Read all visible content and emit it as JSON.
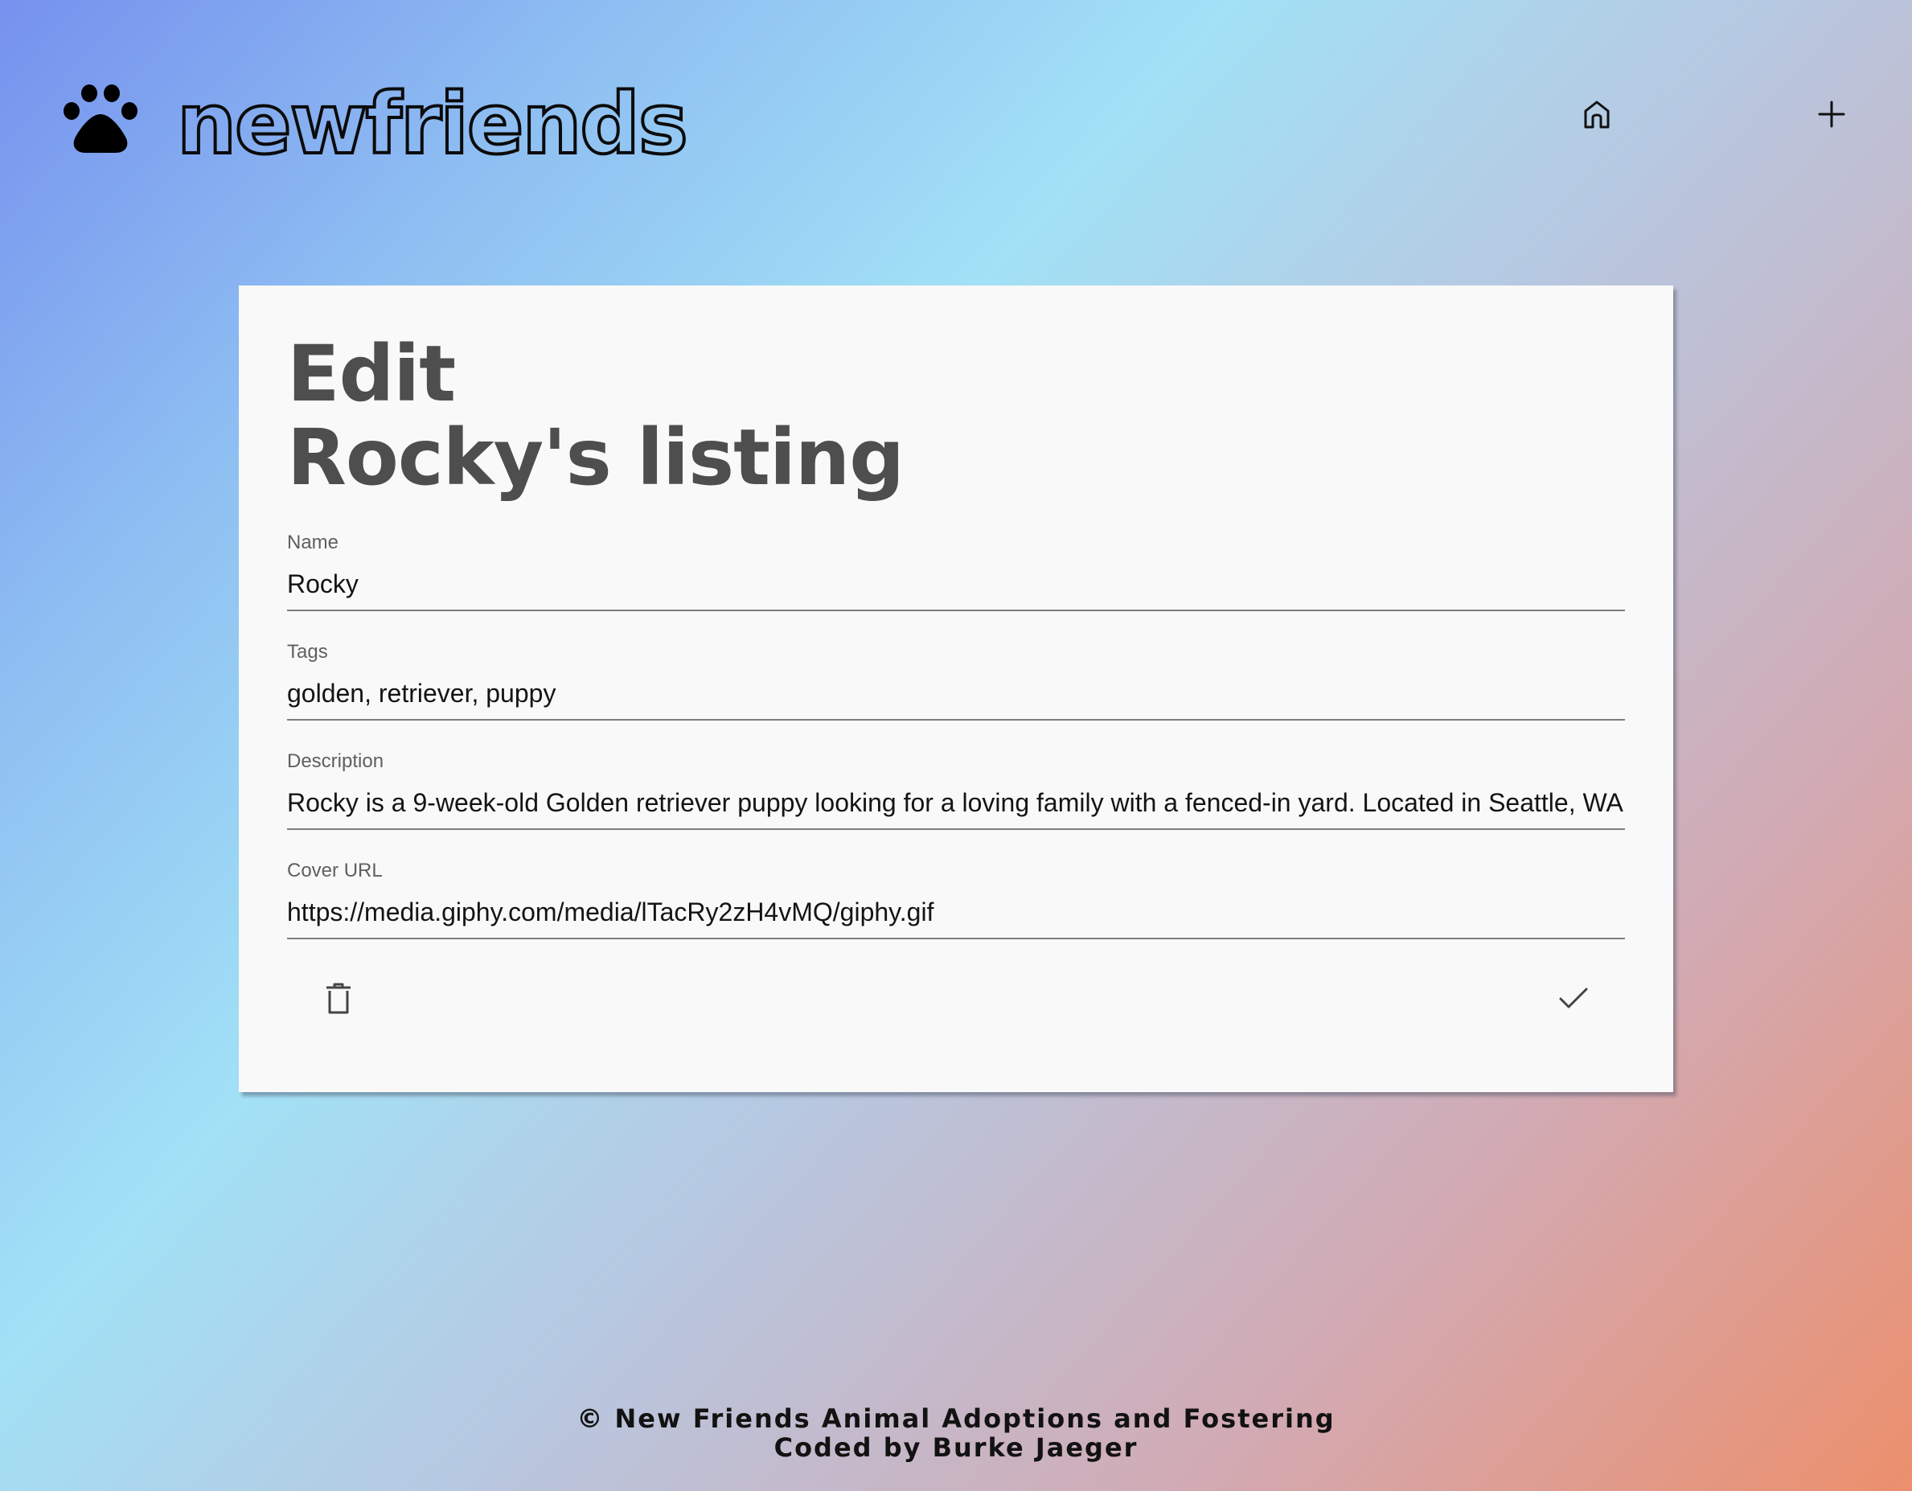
{
  "header": {
    "brand": "newfriends",
    "logo_icon": "paw-icon",
    "nav": [
      {
        "icon": "home-icon"
      },
      {
        "icon": "plus-icon"
      }
    ]
  },
  "edit_form": {
    "title_line1": "Edit",
    "title_line2": "Rocky's listing",
    "fields": {
      "name": {
        "label": "Name",
        "value": "Rocky"
      },
      "tags": {
        "label": "Tags",
        "value": "golden, retriever, puppy"
      },
      "description": {
        "label": "Description",
        "value": "Rocky is a 9-week-old Golden retriever puppy looking for a loving family with a fenced-in yard. Located in Seattle, WA"
      },
      "cover_url": {
        "label": "Cover URL",
        "value": "https://media.giphy.com/media/lTacRy2zH4vMQ/giphy.gif"
      }
    },
    "actions": {
      "delete_icon": "trash-icon",
      "save_icon": "checkmark-icon"
    }
  },
  "footer": {
    "line1": "© New Friends Animal Adoptions and Fostering",
    "line2": "Coded by Burke Jaeger"
  },
  "colors": {
    "card_background": "#f9f9f9",
    "title_text": "#4e4e4e",
    "brand_outline": "#0b0b0b"
  }
}
